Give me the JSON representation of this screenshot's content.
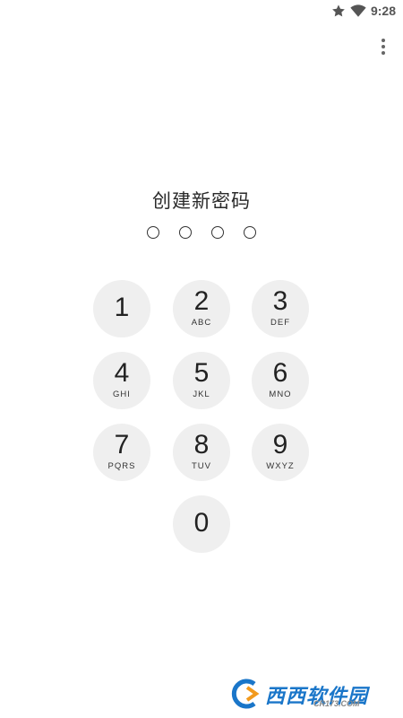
{
  "status_bar": {
    "time": "9:28",
    "icons": [
      "star-icon",
      "wifi-icon"
    ]
  },
  "menu": {
    "icon": "more-vert-icon"
  },
  "title": "创建新密码",
  "pin_dots": 4,
  "keypad": [
    {
      "digit": "1",
      "letters": ""
    },
    {
      "digit": "2",
      "letters": "ABC"
    },
    {
      "digit": "3",
      "letters": "DEF"
    },
    {
      "digit": "4",
      "letters": "GHI"
    },
    {
      "digit": "5",
      "letters": "JKL"
    },
    {
      "digit": "6",
      "letters": "MNO"
    },
    {
      "digit": "7",
      "letters": "PQRS"
    },
    {
      "digit": "8",
      "letters": "TUV"
    },
    {
      "digit": "9",
      "letters": "WXYZ"
    },
    {
      "digit": "0",
      "letters": ""
    }
  ],
  "watermark": {
    "text": "西西软件园",
    "sub": "CR173.COM"
  },
  "colors": {
    "key_background": "#efefef",
    "watermark_blue": "#1a76c9"
  }
}
